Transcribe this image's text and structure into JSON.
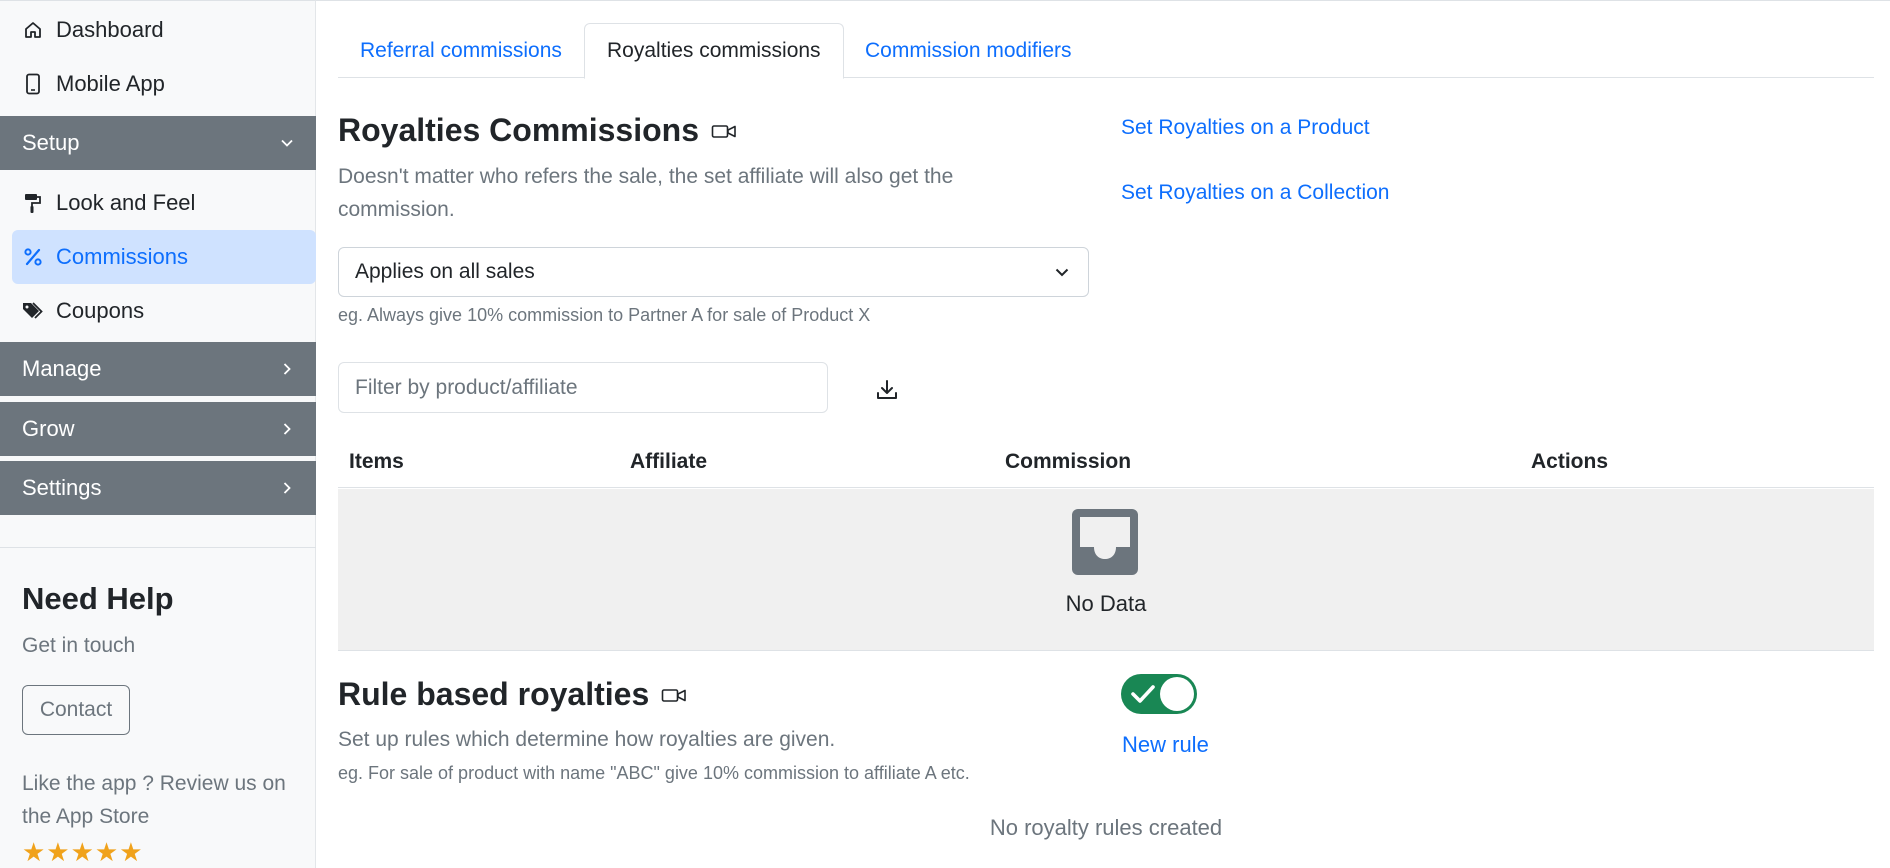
{
  "sidebar": {
    "top_items": [
      {
        "label": "Dashboard",
        "icon": "home-icon"
      },
      {
        "label": "Mobile App",
        "icon": "phone-icon"
      }
    ],
    "sections": [
      {
        "label": "Setup",
        "expanded": true
      },
      {
        "label": "Manage",
        "expanded": false
      },
      {
        "label": "Grow",
        "expanded": false
      },
      {
        "label": "Settings",
        "expanded": false
      }
    ],
    "setup_items": [
      {
        "label": "Look and Feel",
        "icon": "paint-roller-icon"
      },
      {
        "label": "Commissions",
        "icon": "percent-icon",
        "active": true
      },
      {
        "label": "Coupons",
        "icon": "tags-icon"
      }
    ],
    "help": {
      "title": "Need Help",
      "subtitle": "Get in touch",
      "contact_label": "Contact",
      "review_text": "Like the app ? Review us on the App Store",
      "stars": "★★★★★",
      "rating": 5
    }
  },
  "tabs": [
    {
      "label": "Referral commissions",
      "active": false
    },
    {
      "label": "Royalties commissions",
      "active": true
    },
    {
      "label": "Commission modifiers",
      "active": false
    }
  ],
  "royalties": {
    "title": "Royalties Commissions",
    "description": "Doesn't matter who refers the sale, the set affiliate will also get the commission.",
    "link_product": "Set Royalties on a Product",
    "link_collection": "Set Royalties on a Collection",
    "select_value": "Applies on all sales",
    "hint": "eg. Always give 10% commission to Partner A for sale of Product X",
    "filter_placeholder": "Filter by product/affiliate",
    "filter_value": "",
    "table": {
      "columns": [
        "Items",
        "Affiliate",
        "Commission",
        "Actions"
      ],
      "rows": [],
      "empty_text": "No Data"
    }
  },
  "rules": {
    "title": "Rule based royalties",
    "description": "Set up rules which determine how royalties are given.",
    "hint": "eg. For sale of product with name \"ABC\" give 10% commission to affiliate A etc.",
    "toggle_on": true,
    "new_rule_label": "New rule",
    "empty_text": "No royalty rules created"
  },
  "colors": {
    "accent": "#0d6efd",
    "section_bg": "#6c757d",
    "active_bg": "#cfe2ff",
    "toggle_on": "#198754",
    "star": "#f0a21b"
  }
}
